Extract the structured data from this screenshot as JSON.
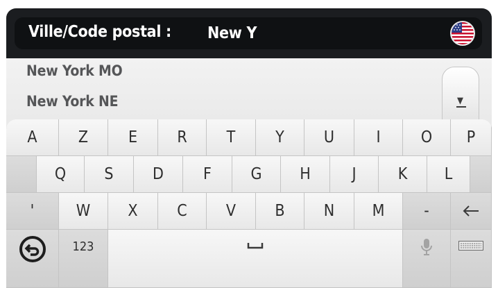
{
  "header": {
    "label": "Ville/Code postal :",
    "value": "New Y",
    "flag_icon": "us-flag-icon"
  },
  "results": [
    {
      "label": "New York MO"
    },
    {
      "label": "New York NE"
    }
  ],
  "scroll_icon": "scroll-down-icon",
  "keyboard": {
    "row1": [
      "A",
      "Z",
      "E",
      "R",
      "T",
      "Y",
      "U",
      "I",
      "O",
      "P"
    ],
    "row2": [
      "Q",
      "S",
      "D",
      "F",
      "G",
      "H",
      "J",
      "K",
      "L"
    ],
    "row3": [
      "'",
      "W",
      "X",
      "C",
      "V",
      "B",
      "N",
      "M",
      "-"
    ],
    "backspace_icon": "backspace-icon",
    "back_icon": "back-icon",
    "numbers_label": "123",
    "space_icon": "space-icon",
    "mic_icon": "microphone-icon",
    "layout_icon": "keyboard-layout-icon"
  },
  "colors": {
    "frame": "#1b1d20",
    "header": "#0f1113",
    "key": "#f2f2f2",
    "key_alt": "#d4d4d4",
    "result_text": "#555658"
  }
}
